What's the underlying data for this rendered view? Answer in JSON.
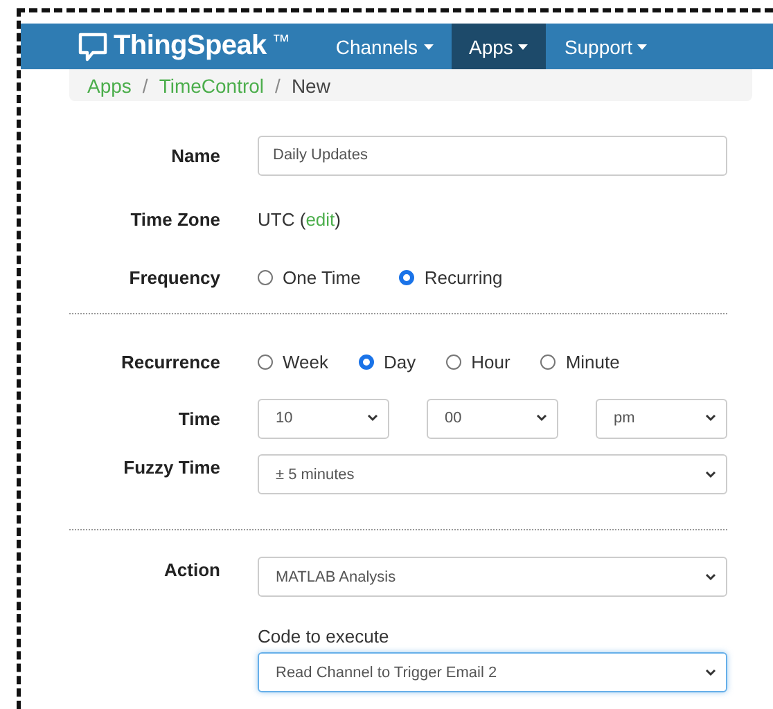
{
  "navbar": {
    "brand": "ThingSpeak",
    "trademark": "™",
    "items": [
      {
        "label": "Channels",
        "selected": false
      },
      {
        "label": "Apps",
        "selected": true
      },
      {
        "label": "Support",
        "selected": false
      }
    ]
  },
  "breadcrumb": [
    {
      "kind": "link",
      "label": "Apps"
    },
    {
      "kind": "separator",
      "label": "/"
    },
    {
      "kind": "link",
      "label": "TimeControl"
    },
    {
      "kind": "separator",
      "label": "/"
    },
    {
      "kind": "current",
      "label": "New"
    }
  ],
  "form": [
    {
      "kind": "input",
      "label": "Name",
      "value": "Daily Updates"
    },
    {
      "kind": "text",
      "label": "Time Zone",
      "value": "UTC",
      "prefix": "(",
      "link": "edit",
      "suffix": ")"
    },
    {
      "kind": "radio",
      "label": "Frequency",
      "options": [
        {
          "label": "One Time",
          "selected": false
        },
        {
          "label": "Recurring",
          "selected": true
        }
      ]
    },
    {
      "kind": "divider"
    },
    {
      "kind": "radio",
      "label": "Recurrence",
      "options": [
        {
          "label": "Week",
          "selected": false
        },
        {
          "label": "Day",
          "selected": true
        },
        {
          "label": "Hour",
          "selected": false
        },
        {
          "label": "Minute",
          "selected": false
        }
      ]
    },
    {
      "kind": "selects",
      "label": "Time",
      "values": [
        "10",
        "00",
        "pm"
      ]
    },
    {
      "kind": "select",
      "label": "Fuzzy Time",
      "value": "± 5 minutes"
    },
    {
      "kind": "divider"
    },
    {
      "kind": "select",
      "label": "Action",
      "value": "MATLAB Analysis"
    },
    {
      "kind": "captioned-select",
      "caption": "Code to execute",
      "value": "Read Channel to Trigger Email 2",
      "focused": true
    }
  ]
}
